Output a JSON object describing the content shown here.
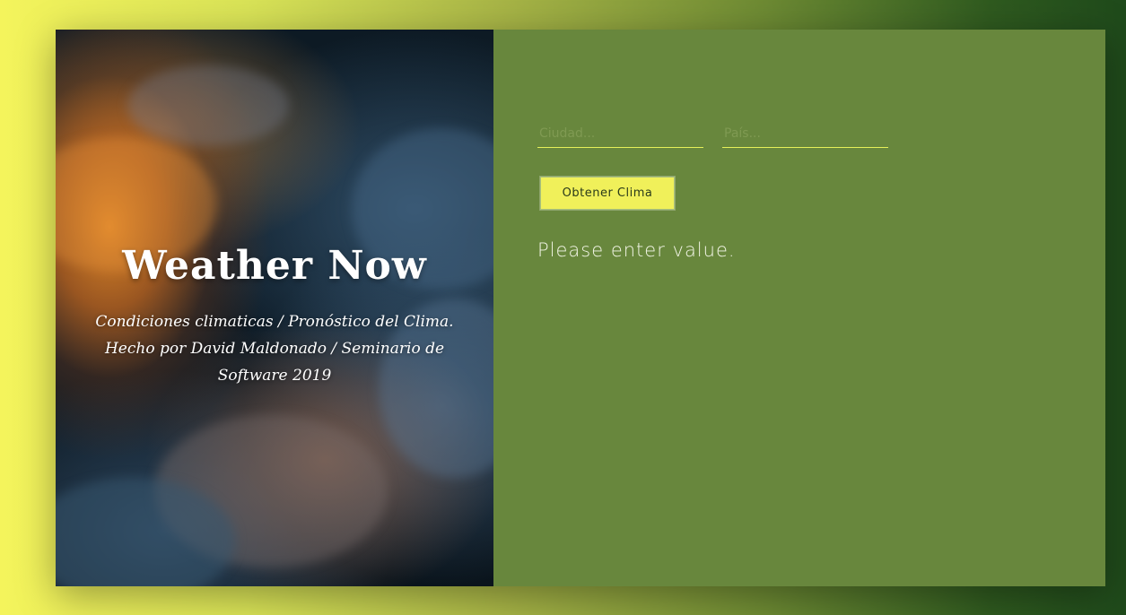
{
  "hero": {
    "title": "Weather Now",
    "subtitle": "Condiciones climaticas / Pronóstico del Clima. Hecho por David Maldonado / Seminario de Software 2019",
    "background": "sunset-clouds-photo"
  },
  "form": {
    "city_placeholder": "Ciudad...",
    "country_placeholder": "País...",
    "submit_label": "Obtener Clima"
  },
  "result": {
    "message": "Please enter value."
  },
  "colors": {
    "panel": "#68873d",
    "accent": "#f0f05a",
    "page_gradient_start": "#f4f45c",
    "page_gradient_end": "#1f4a1b"
  }
}
